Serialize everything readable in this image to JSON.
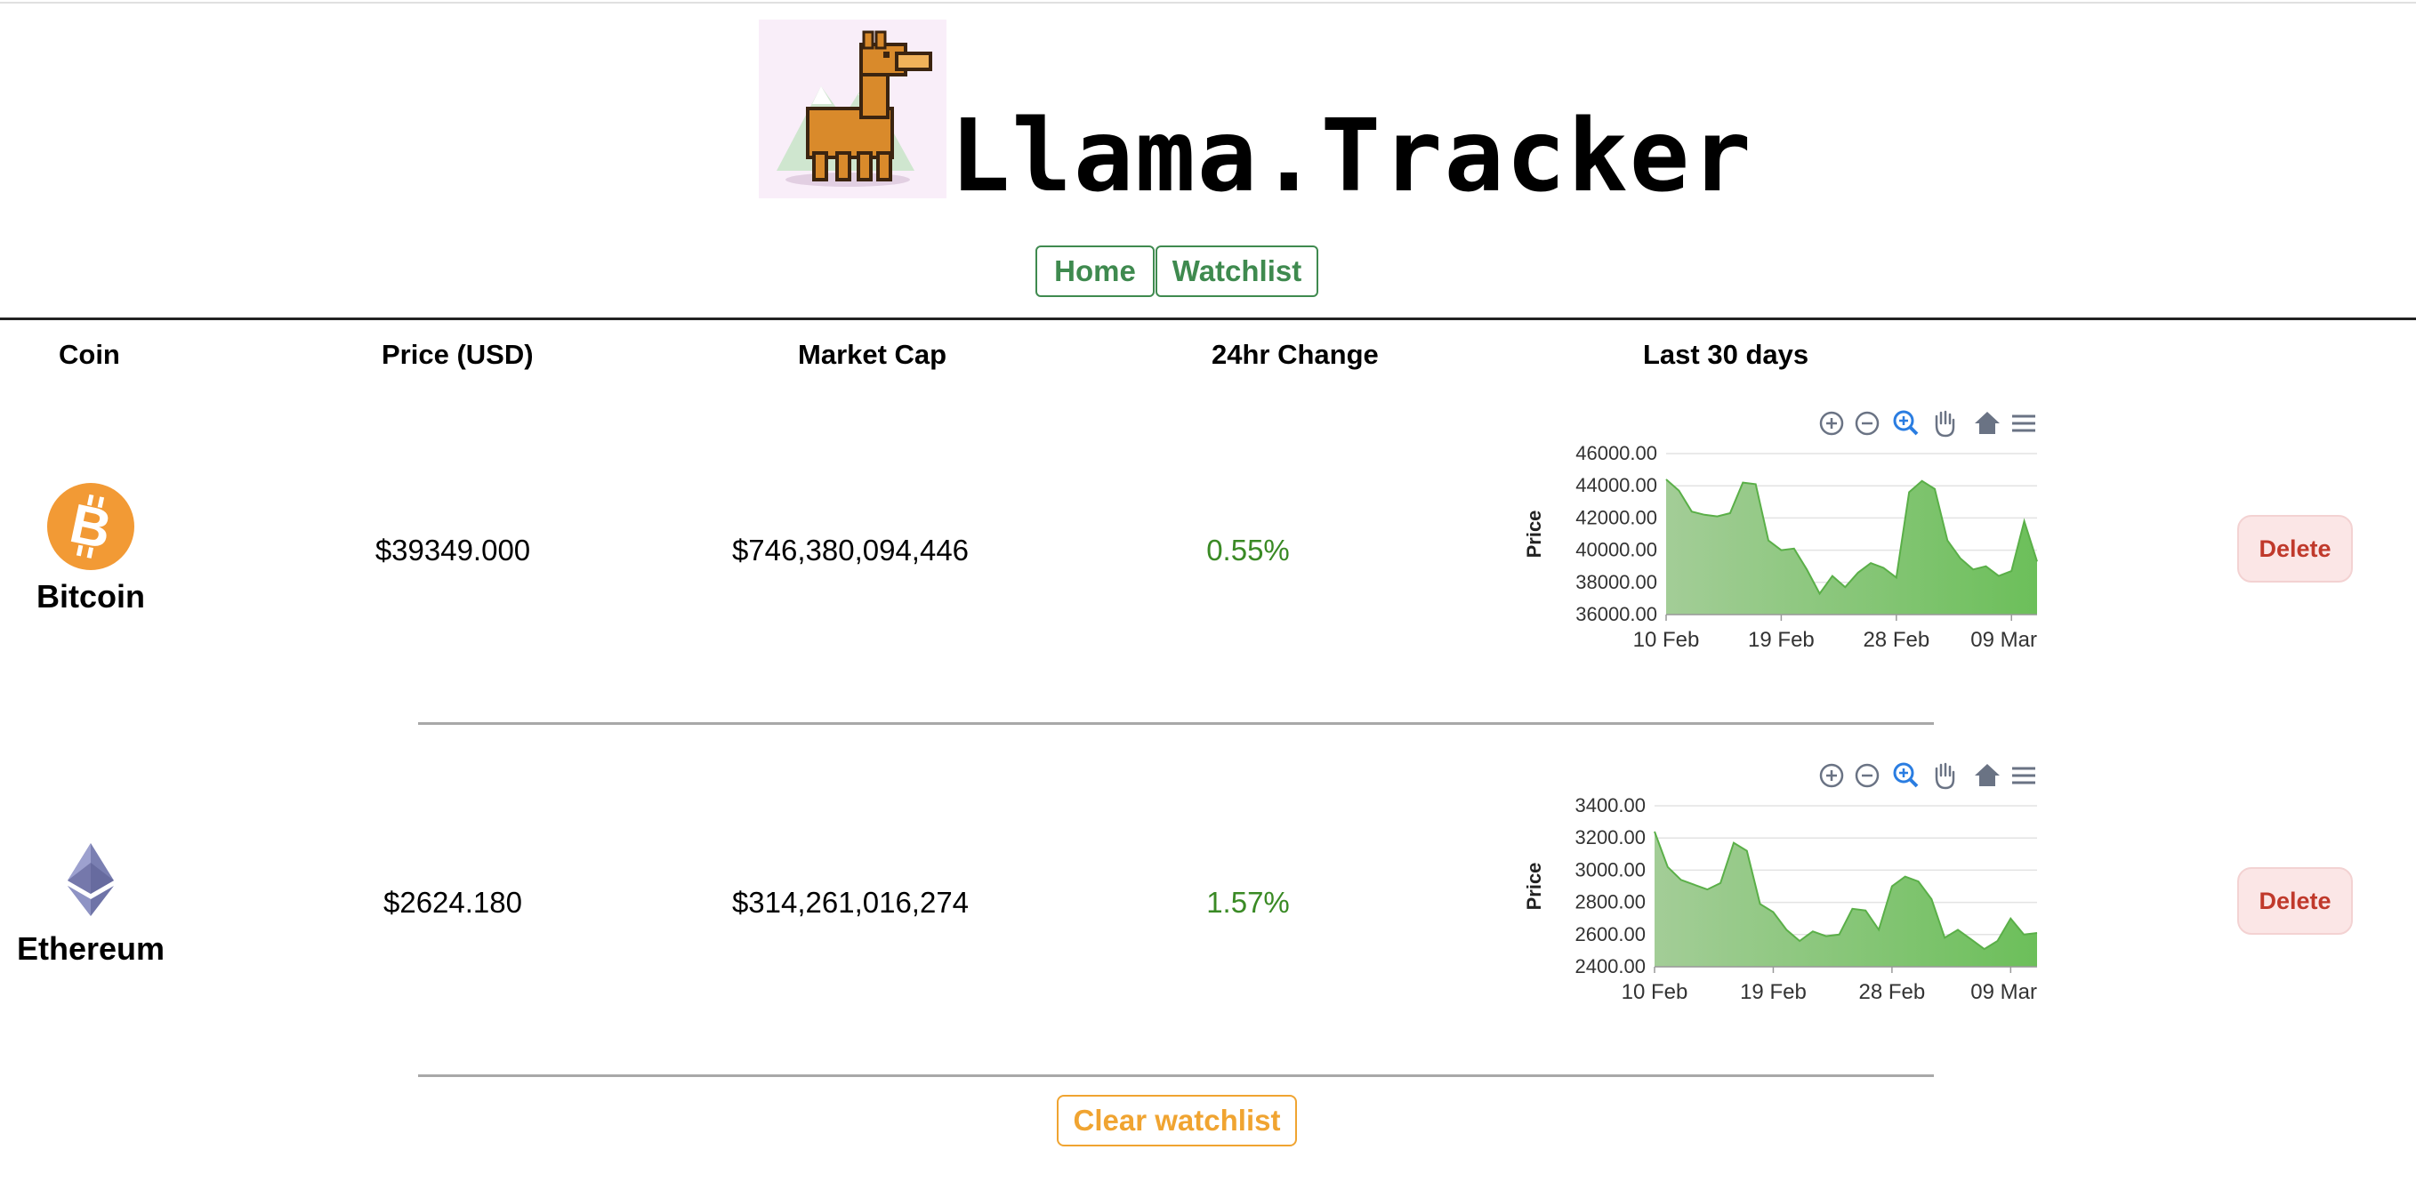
{
  "app": {
    "title": "Llama.Tracker",
    "logo_icon": "llama-icon"
  },
  "nav": {
    "home_label": "Home",
    "watchlist_label": "Watchlist",
    "accent": "#3f8a4f"
  },
  "table": {
    "headers": [
      "Coin",
      "Price (USD)",
      "Market Cap",
      "24hr Change",
      "Last 30 days"
    ],
    "rows": [
      {
        "name": "Bitcoin",
        "icon": "bitcoin-icon",
        "price": "$39349.000",
        "market_cap": "$746,380,094,446",
        "change": "0.55%",
        "delete_label": "Delete"
      },
      {
        "name": "Ethereum",
        "icon": "ethereum-icon",
        "price": "$2624.180",
        "market_cap": "$314,261,016,274",
        "change": "1.57%",
        "delete_label": "Delete"
      }
    ]
  },
  "chart_toolbar": [
    "zoom-in-icon",
    "zoom-out-icon",
    "zoom-selection-icon",
    "pan-icon",
    "reset-home-icon",
    "menu-icon"
  ],
  "chart_data": [
    {
      "type": "area",
      "ylabel": "Price",
      "ylim": [
        36000,
        46000
      ],
      "yticks": [
        "46000.00",
        "44000.00",
        "42000.00",
        "40000.00",
        "38000.00",
        "36000.00"
      ],
      "xticks": [
        "10 Feb",
        "19 Feb",
        "28 Feb",
        "09 Mar"
      ],
      "x": [
        "10 Feb",
        "11 Feb",
        "12 Feb",
        "13 Feb",
        "14 Feb",
        "15 Feb",
        "16 Feb",
        "17 Feb",
        "18 Feb",
        "19 Feb",
        "20 Feb",
        "21 Feb",
        "22 Feb",
        "23 Feb",
        "24 Feb",
        "25 Feb",
        "26 Feb",
        "27 Feb",
        "28 Feb",
        "01 Mar",
        "02 Mar",
        "03 Mar",
        "04 Mar",
        "05 Mar",
        "06 Mar",
        "07 Mar",
        "08 Mar",
        "09 Mar",
        "10 Mar",
        "11 Mar"
      ],
      "values": [
        44400,
        43700,
        42400,
        42200,
        42100,
        42300,
        44200,
        44100,
        40600,
        40000,
        40100,
        38800,
        37300,
        38400,
        37700,
        38600,
        39200,
        38900,
        38300,
        43600,
        44300,
        43800,
        40600,
        39500,
        38800,
        39000,
        38400,
        38700,
        41800,
        39300
      ],
      "color": "#6cbf5a",
      "grid": true
    },
    {
      "type": "area",
      "ylabel": "Price",
      "ylim": [
        2400,
        3400
      ],
      "yticks": [
        "3400.00",
        "3200.00",
        "3000.00",
        "2800.00",
        "2600.00",
        "2400.00"
      ],
      "xticks": [
        "10 Feb",
        "19 Feb",
        "28 Feb",
        "09 Mar"
      ],
      "x": [
        "10 Feb",
        "11 Feb",
        "12 Feb",
        "13 Feb",
        "14 Feb",
        "15 Feb",
        "16 Feb",
        "17 Feb",
        "18 Feb",
        "19 Feb",
        "20 Feb",
        "21 Feb",
        "22 Feb",
        "23 Feb",
        "24 Feb",
        "25 Feb",
        "26 Feb",
        "27 Feb",
        "28 Feb",
        "01 Mar",
        "02 Mar",
        "03 Mar",
        "04 Mar",
        "05 Mar",
        "06 Mar",
        "07 Mar",
        "08 Mar",
        "09 Mar",
        "10 Mar",
        "11 Mar"
      ],
      "values": [
        3240,
        3020,
        2940,
        2910,
        2880,
        2920,
        3170,
        3120,
        2790,
        2740,
        2630,
        2560,
        2620,
        2590,
        2600,
        2760,
        2750,
        2630,
        2900,
        2960,
        2930,
        2820,
        2580,
        2630,
        2570,
        2510,
        2560,
        2700,
        2600,
        2610
      ],
      "color": "#6cbf5a",
      "grid": true
    }
  ],
  "footer": {
    "clear_label": "Clear watchlist",
    "clear_color": "#f0a431"
  },
  "colors": {
    "positive": "#3a8a25",
    "delete_text": "#c0392b",
    "delete_bg": "#fbe6e6"
  }
}
